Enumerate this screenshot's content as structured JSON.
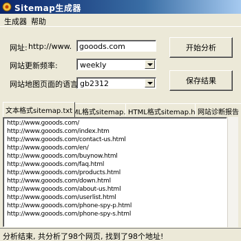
{
  "window": {
    "title": "Sitemap生成器"
  },
  "menu": {
    "items": [
      "生成器",
      "帮助"
    ]
  },
  "form": {
    "url_label": "网址:",
    "url_prefix": "http://www.",
    "url_value": "gooods.com",
    "frequency_label": "网站更新频率:",
    "frequency_value": "weekly",
    "language_label": "网站地图页面的语言:",
    "language_value": "gb2312"
  },
  "buttons": {
    "start": "开始分析",
    "save": "保存结果"
  },
  "tabs": [
    "文本格式sitemap.txt",
    "XML格式sitemap.xml",
    "HTML格式sitemap.html",
    "网站诊断报告"
  ],
  "output_lines": [
    "http://www.gooods.com/",
    "http://www.gooods.com/index.htm",
    "http://www.gooods.com/contact-us.html",
    "http://www.gooods.com/en/",
    "http://www.gooods.com/buynow.html",
    "http://www.gooods.com/faq.html",
    "http://www.gooods.com/products.html",
    "http://www.gooods.com/down.html",
    "http://www.gooods.com/about-us.html",
    "http://www.gooods.com/userlist.html",
    "http://www.gooods.com/phone-spy-p.html",
    "http://www.gooods.com/phone-spy-s.html"
  ],
  "status": {
    "text": "分析结束, 共分析了98个网页, 找到了98个地址!"
  }
}
